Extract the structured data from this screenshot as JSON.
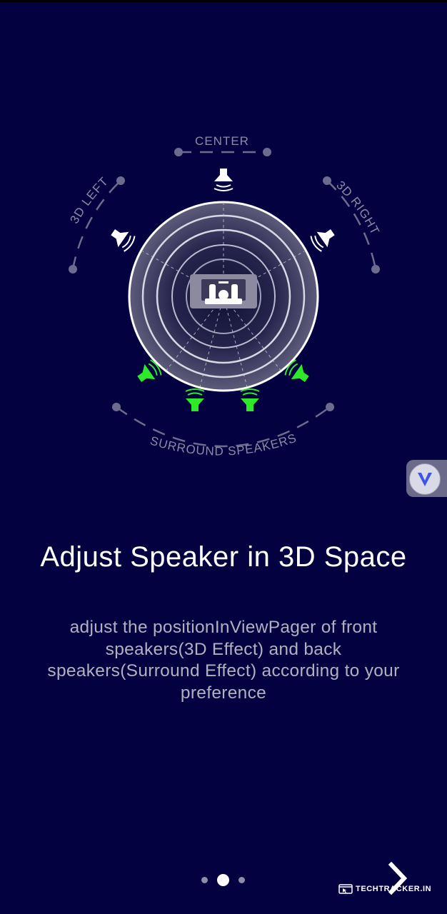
{
  "diagram": {
    "labels": {
      "center": "CENTER",
      "left": "3D LEFT",
      "right": "3D RIGHT",
      "surround": "SURROUND SPEAKERS"
    }
  },
  "content": {
    "title": "Adjust Speaker in 3D Space",
    "description": "adjust the positionInViewPager of front speakers(3D Effect) and back speakers(Surround Effect) according to your preference"
  },
  "pager": {
    "pages": 3,
    "current": 2
  },
  "navigation": {
    "next_icon": "chevron-right-icon"
  },
  "overlay": {
    "badge_icon": "v-logo-icon"
  },
  "watermark": {
    "text": "TECHTRACKER.IN",
    "icon": "browser-cursor-icon"
  },
  "colors": {
    "background": "#03013f",
    "front_speaker": "#ffffff",
    "surround_speaker": "#2ee82a",
    "label": "#8c8aa6"
  }
}
